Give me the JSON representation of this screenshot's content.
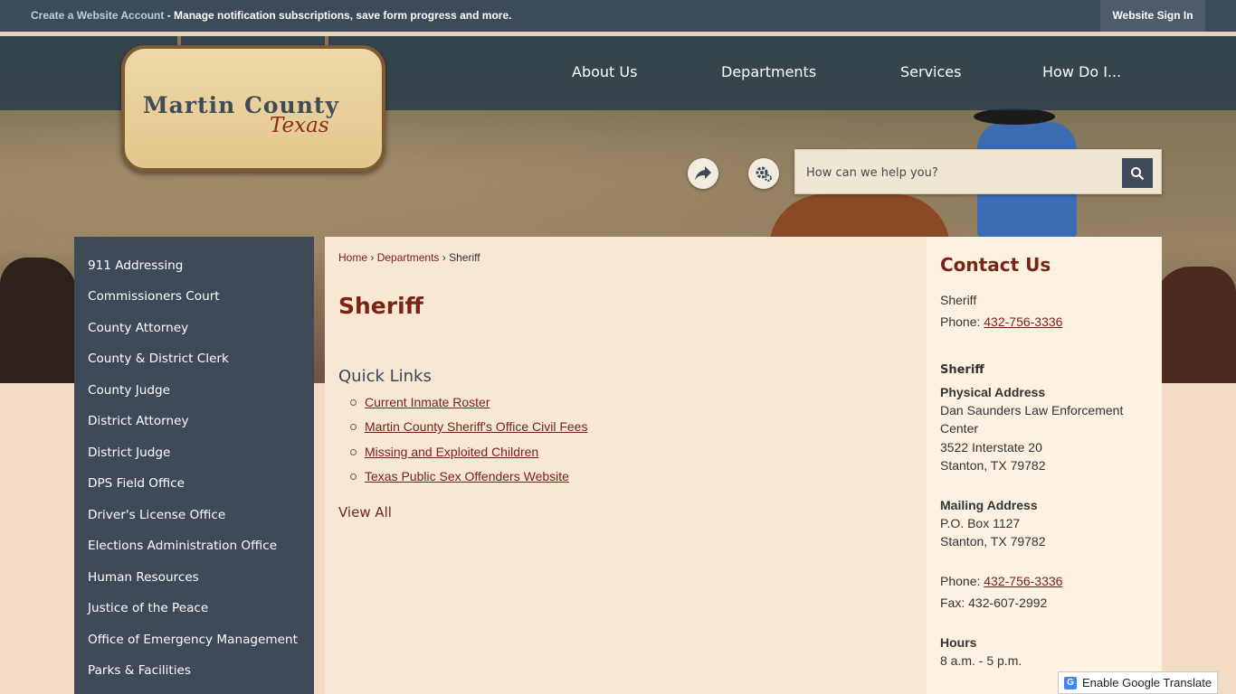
{
  "topbar": {
    "create_account_link": "Create a Website Account",
    "create_account_text": " - Manage notification subscriptions, save form progress and more.",
    "sign_in": "Website Sign In"
  },
  "logo": {
    "line1": "Martin County",
    "line2": "Texas"
  },
  "nav": [
    "About Us",
    "Departments",
    "Services",
    "How Do I..."
  ],
  "search": {
    "placeholder": "How can we help you?"
  },
  "icons": {
    "share": "share-icon",
    "tools": "gear-icon",
    "search": "search-icon"
  },
  "sidebar": {
    "items": [
      "911 Addressing",
      "Commissioners Court",
      "County Attorney",
      "County & District Clerk",
      "County Judge",
      "District Attorney",
      "District Judge",
      "DPS Field Office",
      "Driver's License Office",
      "Elections Administration Office",
      "Human Resources",
      "Justice of the Peace",
      "Office of Emergency Management",
      "Parks & Facilities"
    ]
  },
  "breadcrumb": {
    "home": "Home",
    "sep1": "›",
    "departments": "Departments",
    "sep2": "›",
    "current": "Sheriff"
  },
  "page": {
    "title": "Sheriff"
  },
  "quick_links": {
    "title": "Quick Links",
    "items": [
      "Current Inmate Roster",
      "Martin County Sheriff's Office Civil Fees",
      "Missing and Exploited Children",
      "Texas Public Sex Offenders Website"
    ],
    "view_all": "View All"
  },
  "contact": {
    "heading": "Contact Us",
    "name": "Sheriff",
    "phone_label": "Phone: ",
    "phone": "432-756-3336",
    "section": "Sheriff",
    "physical_label": "Physical Address",
    "physical_line1": "Dan Saunders Law Enforcement",
    "physical_line2": "Center",
    "physical_line3": "3522 Interstate 20",
    "physical_line4": "Stanton, TX 79782",
    "mailing_label": "Mailing Address",
    "mailing_line1": "P.O. Box 1127",
    "mailing_line2": "Stanton, TX 79782",
    "phone2_label": "Phone: ",
    "phone2": "432-756-3336",
    "fax": "Fax: 432-607-2992",
    "hours_label": "Hours",
    "hours": "8 a.m. - 5 p.m."
  },
  "translate": {
    "label": "Enable Google Translate"
  },
  "colors": {
    "accent": "#7a2417",
    "nav_bg": "#3e4a58",
    "content_bg": "#f8e7d3"
  }
}
